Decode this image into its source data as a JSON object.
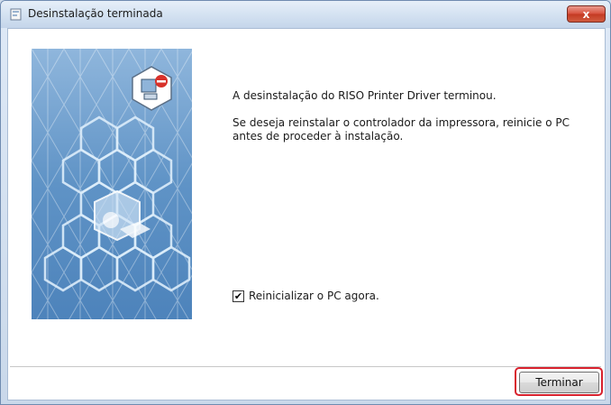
{
  "window": {
    "title": "Desinstalação terminada",
    "close_label": "x"
  },
  "content": {
    "message_line1": "A desinstalação do RISO Printer Driver terminou.",
    "message_line2": "Se deseja reinstalar o controlador da impressora, reinicie o PC antes de proceder à instalação."
  },
  "options": {
    "restart_label": "Reinicializar o PC agora.",
    "restart_checked": true,
    "check_glyph": "✔"
  },
  "buttons": {
    "finish_label": "Terminar"
  },
  "colors": {
    "highlight": "#d8222e",
    "art_background": "#6f9fcb"
  }
}
